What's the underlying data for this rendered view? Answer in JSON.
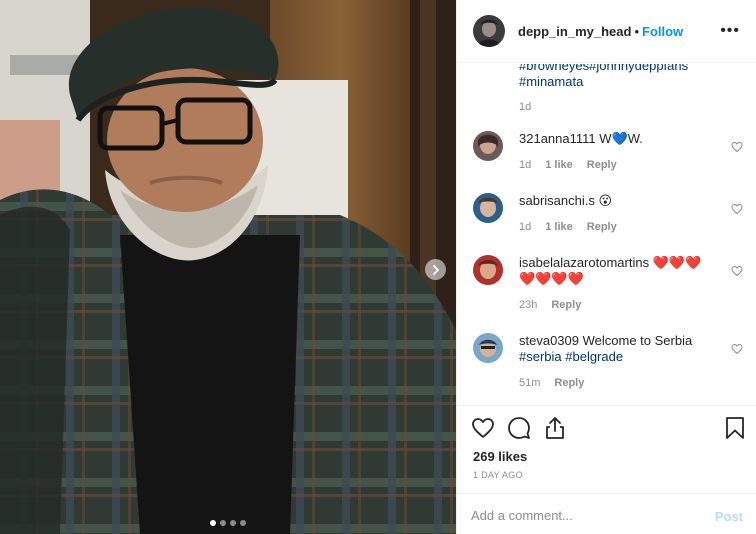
{
  "post": {
    "username": "depp_in_my_head",
    "follow_label": "Follow",
    "dot": "•",
    "more_label": "•••",
    "caption_tail": {
      "line1": "#browneyes#johnnydeppfans",
      "line2": "#minamata"
    },
    "caption_time": "1d",
    "likes": "269 likes",
    "posted_ago": "1 DAY AGO",
    "add_comment_placeholder": "Add a comment...",
    "post_label": "Post",
    "carousel_pages": 4,
    "carousel_active": 1
  },
  "comments": [
    {
      "user": "321anna1111",
      "text": "W💙W.",
      "tags": "",
      "tags2": "",
      "time": "1d",
      "likes": "1 like",
      "reply": "Reply"
    },
    {
      "user": "sabrisanchi.s",
      "text": "😮",
      "tags": "",
      "tags2": "",
      "time": "1d",
      "likes": "1 like",
      "reply": "Reply"
    },
    {
      "user": "isabelalazarotomartins",
      "text": "❤️❤️❤️",
      "tags": "❤️❤️❤️❤️",
      "tags2": "",
      "time": "23h",
      "likes": "",
      "reply": "Reply"
    },
    {
      "user": "steva0309",
      "text": "Welcome to Serbia",
      "tags": "#serbia #belgrade",
      "tags2": "",
      "time": "51m",
      "likes": "",
      "reply": "Reply"
    }
  ],
  "icons": {
    "like": "heart-icon",
    "comment": "comment-icon",
    "share": "share-icon",
    "save": "bookmark-icon",
    "next": "chevron-right-icon",
    "comment_like": "small-heart-icon"
  },
  "colors": {
    "link": "#0095f6",
    "hashtag": "#00376b",
    "muted": "#8e8e8e",
    "post_disabled": "#b2dffc"
  }
}
